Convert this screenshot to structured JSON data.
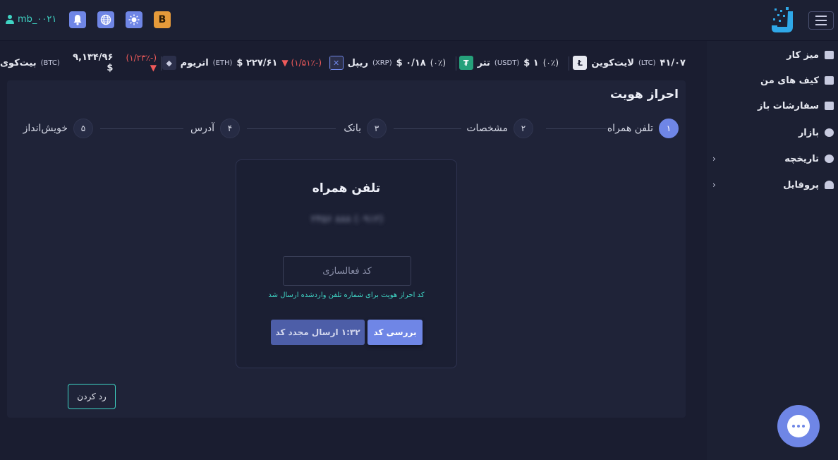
{
  "header": {
    "username": "mb_۰۰۲۱",
    "icons": [
      "bell-icon",
      "globe-icon",
      "sun-icon",
      "b-badge-icon"
    ],
    "b_label": "B"
  },
  "sidebar": {
    "items": [
      {
        "label": "میز کار",
        "icon": "monitor-icon",
        "has_chevron": false
      },
      {
        "label": "کیف های من",
        "icon": "wallet-icon",
        "has_chevron": false
      },
      {
        "label": "سفارشات باز",
        "icon": "list-icon",
        "has_chevron": false
      },
      {
        "label": "بازار",
        "icon": "chart-pie-icon",
        "has_chevron": false
      },
      {
        "label": "تاریخچه",
        "icon": "history-icon",
        "has_chevron": true
      },
      {
        "label": "پروفایل",
        "icon": "user-icon",
        "has_chevron": true
      }
    ]
  },
  "ticker": [
    {
      "name": "لایت‌کوین",
      "symbol": "(LTC)",
      "price": "۴۱/۰۷",
      "change": "",
      "icon": "litecoin-icon"
    },
    {
      "name": "تتر",
      "symbol": "(USDT)",
      "price": "۱ $",
      "change": "(۰٪)",
      "icon": "tether-icon"
    },
    {
      "name": "ریپل",
      "symbol": "(XRP)",
      "price": "۰/۱۸ $",
      "change": "(۰٪)",
      "icon": "ripple-icon"
    },
    {
      "name": "اتریوم",
      "symbol": "(ETH)",
      "price": "۲۲۷/۶۱ $",
      "change": "(-۱/۵۱٪)",
      "icon": "ethereum-icon"
    },
    {
      "name": "بیت‌کوی",
      "symbol": "(BTC)",
      "price": "۹,۱۳۴/۹۶ $",
      "change": "(-۱/۲۳٪)",
      "icon": "bitcoin-icon"
    }
  ],
  "page": {
    "title": "احراز هویت"
  },
  "steps": [
    {
      "num": "۱",
      "label": "تلفن همراه",
      "active": true
    },
    {
      "num": "۲",
      "label": "مشخصات",
      "active": false
    },
    {
      "num": "۳",
      "label": "بانک",
      "active": false
    },
    {
      "num": "۴",
      "label": "آدرس",
      "active": false
    },
    {
      "num": "۵",
      "label": "خویش‌انداز",
      "active": false
    }
  ],
  "card": {
    "title": "تلفن همراه",
    "masked_phone": "۲۴۵۶ ۸۸۸ (۰۹۱۲)",
    "code_placeholder": "کد فعالسازی",
    "hint": "کد احراز هویت برای شماره تلفن واردشده ارسال شد",
    "check_button": "بررسی کد",
    "resend_button": "۱:۳۲ ارسال مجدد کد"
  },
  "reject_button": "رد کردن",
  "colors": {
    "accent": "#6f86e6",
    "teal": "#3fd4c4",
    "negative": "#ef5a5a",
    "background": "#1a1d30"
  }
}
